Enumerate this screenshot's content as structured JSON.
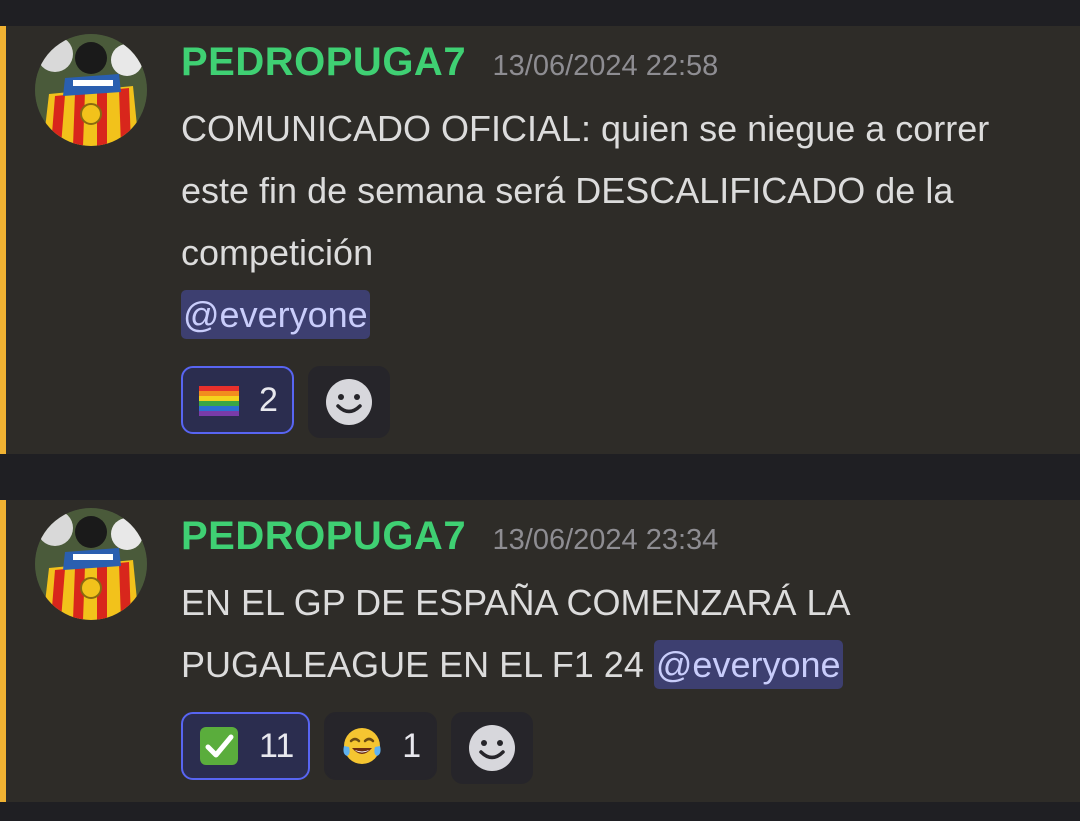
{
  "messages": [
    {
      "author": "PEDROPUGA7",
      "timestamp": "13/06/2024 22:58",
      "text": "COMUNICADO OFICIAL: quien se niegue a correr este fin de semana será DESCALIFICADO de la competición",
      "mention": "@everyone",
      "reactions": [
        {
          "emoji": "rainbow-flag-icon",
          "count": "2",
          "active": true
        }
      ]
    },
    {
      "author": "PEDROPUGA7",
      "timestamp": "13/06/2024 23:34",
      "text": "EN EL GP DE ESPAÑA COMENZARÁ LA PUGALEAGUE EN EL F1 24",
      "mention": "@everyone",
      "reactions": [
        {
          "emoji": "check-mark-icon",
          "count": "11",
          "active": true
        },
        {
          "emoji": "tears-of-joy-icon",
          "count": "1",
          "active": false
        }
      ]
    }
  ],
  "colors": {
    "accent_bar": "#f0b232",
    "author": "#3fd073",
    "mention_bg": "#3d3f70",
    "reaction_active_border": "#5865f2"
  }
}
